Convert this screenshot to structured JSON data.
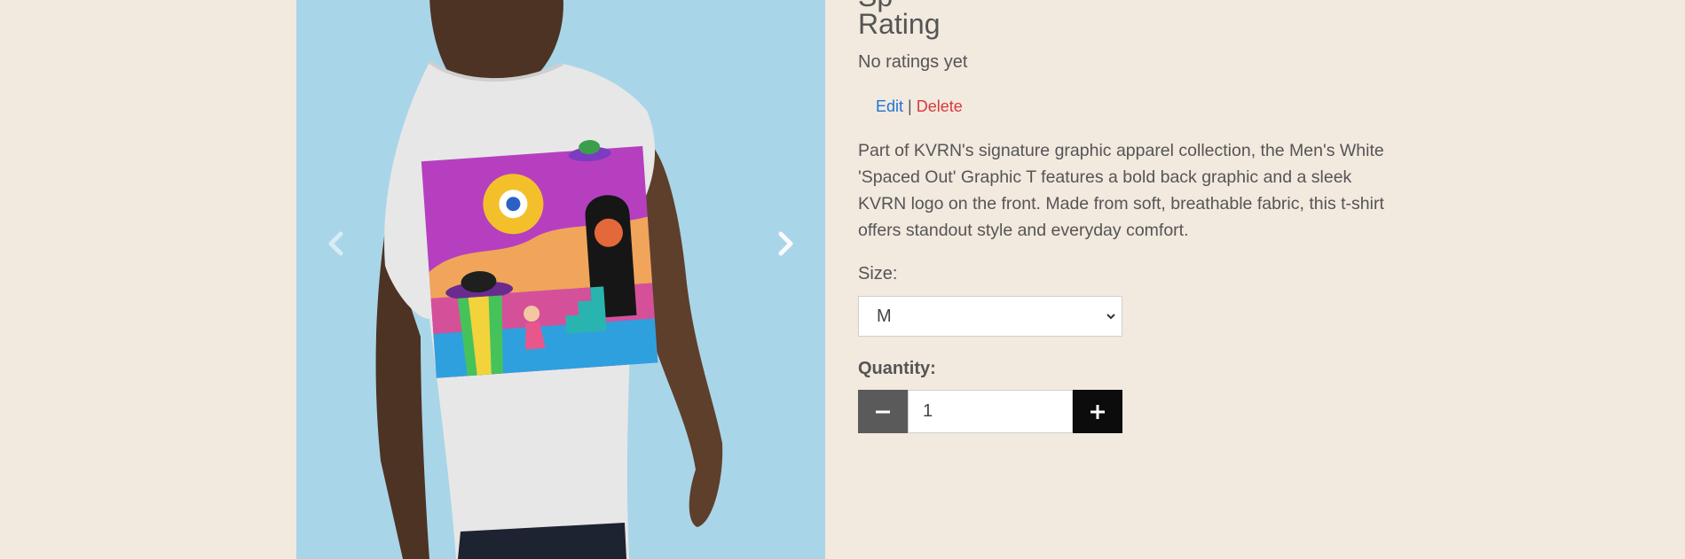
{
  "product": {
    "title_partial": "Sp",
    "rating_heading": "Rating",
    "rating_text": "No ratings yet",
    "actions": {
      "edit": "Edit",
      "separator": "|",
      "delete": "Delete"
    },
    "description": "Part of KVRN's signature graphic apparel collection, the Men's White 'Spaced Out' Graphic T features a bold back graphic and a sleek KVRN logo on the front. Made from soft, breathable fabric, this t-shirt offers standout style and everyday comfort.",
    "size": {
      "label": "Size:",
      "selected": "M"
    },
    "quantity": {
      "label": "Quantity:",
      "value": "1"
    }
  },
  "carousel": {
    "prev_icon": "chevron-left-icon",
    "next_icon": "chevron-right-icon",
    "image": "man-back-white-tshirt-graphic"
  },
  "colors": {
    "page_bg": "#f2e9df",
    "image_bg": "#a9d5e8",
    "edit_link": "#1e74d6",
    "delete_link": "#d63a3a",
    "minus_button": "#5a5a5a",
    "plus_button": "#0c0c0c"
  }
}
